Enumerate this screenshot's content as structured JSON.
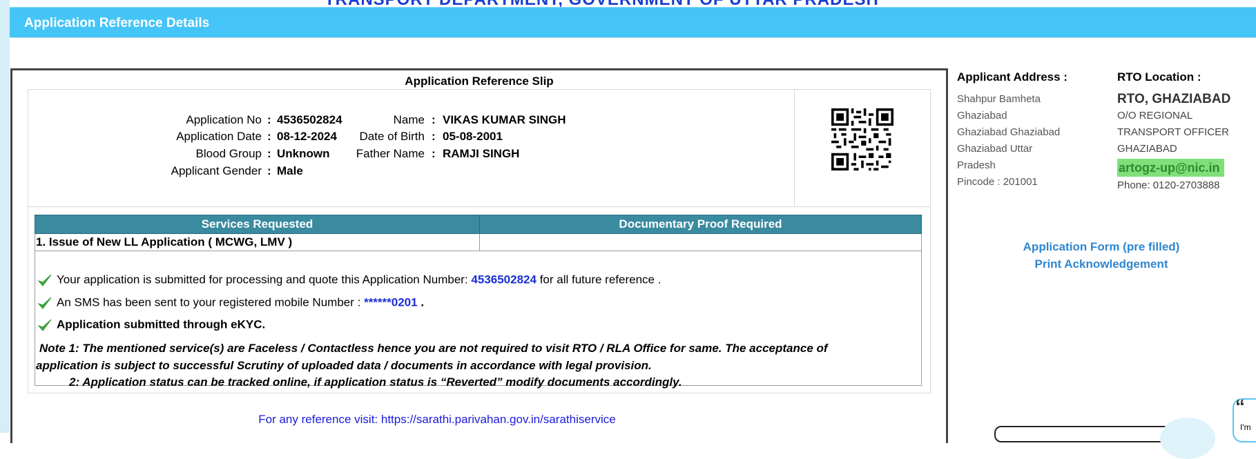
{
  "page": {
    "top_banner": "TRANSPORT DEPARTMENT, GOVERNMENT OF UTTAR PRADESH",
    "panel_title": "Application Reference Details"
  },
  "slip": {
    "title": "Application Reference Slip",
    "fields": {
      "application_no_label": "Application No",
      "application_no": "4536502824",
      "name_label": "Name",
      "name": "VIKAS KUMAR SINGH",
      "application_date_label": "Application Date",
      "application_date": "08-12-2024",
      "dob_label": "Date of Birth",
      "dob": "05-08-2001",
      "blood_group_label": "Blood Group",
      "blood_group": "Unknown",
      "father_name_label": "Father Name",
      "father_name": "RAMJI SINGH",
      "gender_label": "Applicant Gender",
      "gender": "Male",
      "colon": ":"
    },
    "services_table": {
      "headers": [
        "Services Requested",
        "Documentary Proof Required"
      ],
      "rows": [
        [
          "1. Issue of New LL Application ( MCWG, LMV )",
          ""
        ]
      ]
    },
    "messages": {
      "submitted_pre": "Your application is submitted for processing and quote this Application Number:",
      "submitted_number": "4536502824",
      "submitted_post": "for all future reference .",
      "sms_pre": "An SMS has been sent to your registered mobile Number :",
      "sms_number": "******0201",
      "sms_post": ".",
      "ekyc": "Application submitted through eKYC."
    },
    "notes": {
      "note1_line1": "Note 1:  The mentioned service(s) are Faceless / Contactless hence you are not required to visit RTO / RLA Office for same. The acceptance of",
      "note1_line2": "application is subject to successful Scrutiny of uploaded data / documents in accordance with legal provision.",
      "note2": "2:  Application status can be tracked online, if application status is “Reverted” modify documents accordingly."
    },
    "footer": {
      "reference_text": "For any reference visit: https://sarathi.parivahan.gov.in/sarathiservice"
    }
  },
  "applicant_address": {
    "heading": "Applicant Address :",
    "lines": [
      "Shahpur Bamheta",
      "Ghaziabad",
      "Ghaziabad Ghaziabad",
      "Ghaziabad Uttar",
      "Pradesh",
      "Pincode : 201001"
    ]
  },
  "rto_location": {
    "heading": "RTO Location :",
    "name": "RTO, GHAZIABAD",
    "lines": [
      "O/O REGIONAL",
      "TRANSPORT OFFICER",
      "GHAZIABAD"
    ],
    "email": "artogz-up@nic.in",
    "phone": "Phone:  0120-2703888"
  },
  "links": {
    "application_form": "Application Form (pre filled)",
    "print_ack": "Print Acknowledgement"
  },
  "widget": {
    "corner_text": "I'm"
  },
  "colors": {
    "header_bg": "#45c4f7",
    "table_header_bg": "#3a8aa0",
    "number_blue": "#1a2ed8",
    "link_blue": "#2f86cf",
    "email_highlight": "#7fe07a",
    "tick_green": "#3fae3f"
  },
  "icons": {
    "tick": "check-icon",
    "qr": "qr-code-icon",
    "quote": "quote-icon"
  }
}
